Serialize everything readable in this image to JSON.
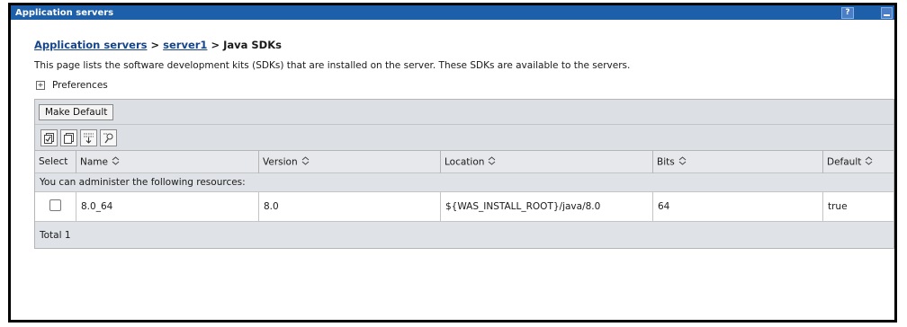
{
  "window": {
    "title": "Application servers",
    "help_label": "?"
  },
  "breadcrumb": {
    "item1": "Application servers",
    "sep1": " > ",
    "item2": "server1",
    "sep2": " > ",
    "current": "Java SDKs"
  },
  "description": "This page lists the software development kits (SDKs) that are installed on the server. These SDKs are available to the servers.",
  "preferences": {
    "expander": "+",
    "label": "Preferences"
  },
  "toolbar": {
    "make_default_label": "Make Default",
    "icons": [
      "select-all-icon",
      "deselect-all-icon",
      "show-filter-icon",
      "clear-filter-icon"
    ]
  },
  "table": {
    "columns": {
      "select": "Select",
      "name": "Name",
      "version": "Version",
      "location": "Location",
      "bits": "Bits",
      "default": "Default"
    },
    "resources_message": "You can administer the following resources:",
    "rows": [
      {
        "name": "8.0_64",
        "version": "8.0",
        "location": "${WAS_INSTALL_ROOT}/java/8.0",
        "bits": "64",
        "default": "true"
      }
    ],
    "total": "Total 1"
  },
  "colors": {
    "titlebar": "#1d5fa8",
    "link": "#16458a",
    "panel": "#dcdfe3"
  }
}
